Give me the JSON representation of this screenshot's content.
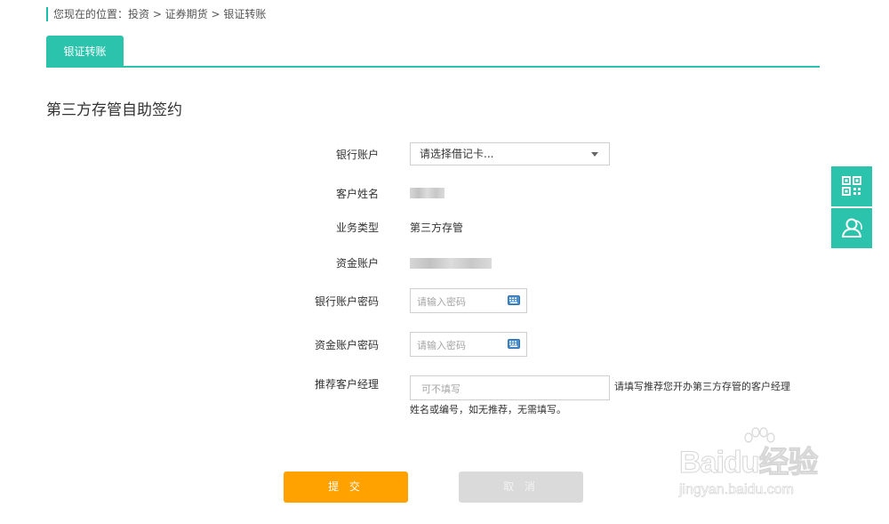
{
  "breadcrumb": {
    "text": "您现在的位置：投资 > 证券期货 > 银证转账"
  },
  "tabs": [
    {
      "label": "银证转账",
      "active": true
    }
  ],
  "page_title": "第三方存管自助签约",
  "form": {
    "bank_account": {
      "label": "银行账户",
      "selected": "请选择借记卡..."
    },
    "customer_name": {
      "label": "客户姓名"
    },
    "business_type": {
      "label": "业务类型",
      "value": "第三方存管"
    },
    "fund_account": {
      "label": "资金账户"
    },
    "bank_password": {
      "label": "银行账户密码",
      "placeholder": "请输入密码"
    },
    "fund_password": {
      "label": "资金账户密码",
      "placeholder": "请输入密码"
    },
    "manager": {
      "label": "推荐客户经理",
      "placeholder": "可不填写",
      "hint_line1": "请填写推荐您开办第三方存管的客户经理",
      "hint_line2": "姓名或编号，如无推荐，无需填写。"
    }
  },
  "buttons": {
    "submit": "提 交",
    "cancel": "取 消"
  },
  "side_tools": [
    {
      "icon": "qr-code-icon"
    },
    {
      "icon": "customer-service-icon"
    }
  ],
  "watermark": {
    "brand": "Baidu经验",
    "url": "jingyan.baidu.com"
  },
  "colors": {
    "accent": "#2cc3ad",
    "submit": "#ffa200",
    "cancel": "#dadada"
  }
}
